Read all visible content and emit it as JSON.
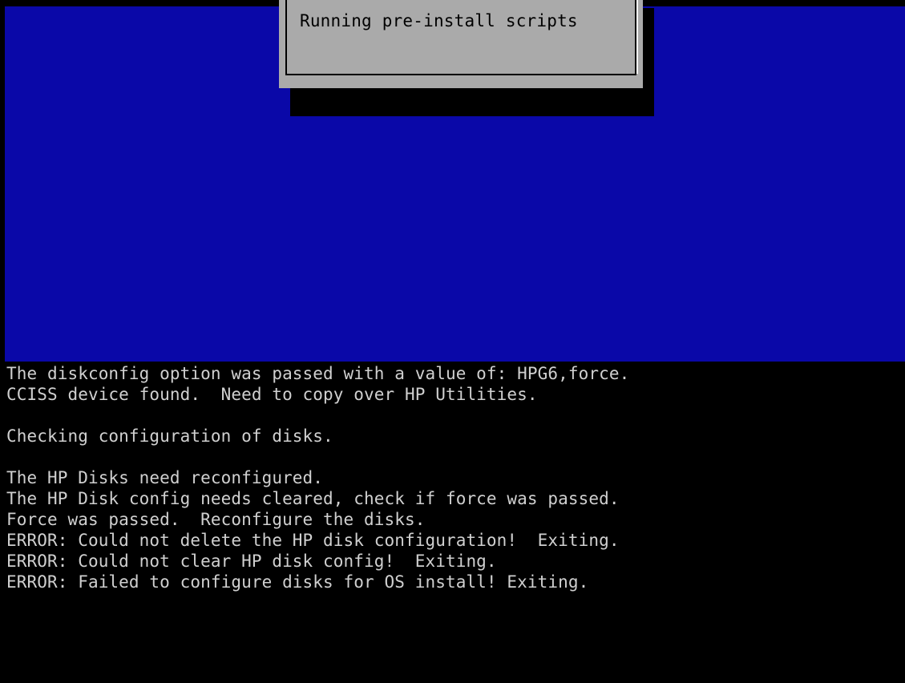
{
  "dialog": {
    "message": "Running pre-install scripts"
  },
  "console": {
    "lines": [
      "The diskconfig option was passed with a value of: HPG6,force.",
      "CCISS device found.  Need to copy over HP Utilities.",
      "",
      "Checking configuration of disks.",
      "",
      "The HP Disks need reconfigured.",
      "The HP Disk config needs cleared, check if force was passed.",
      "Force was passed.  Reconfigure the disks.",
      "ERROR: Could not delete the HP disk configuration!  Exiting.",
      "ERROR: Could not clear HP disk config!  Exiting.",
      "ERROR: Failed to configure disks for OS install! Exiting."
    ]
  },
  "colors": {
    "background_blue": "#0A08A8",
    "dialog_gray": "#AAAAAA",
    "console_text": "#D0D0D0",
    "console_bg": "#000000"
  }
}
